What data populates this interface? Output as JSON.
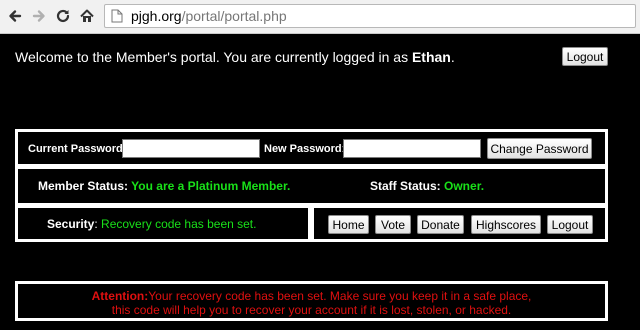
{
  "browser": {
    "url_domain": "pjgh.org",
    "url_path": "/portal/portal.php"
  },
  "welcome": {
    "prefix": "Welcome to the Member's portal. You are currently logged in as ",
    "username": "Ethan",
    "suffix": "."
  },
  "header": {
    "logout_label": "Logout"
  },
  "password": {
    "current_label": "Current Password",
    "new_label": "New Password",
    "colon": ":",
    "current_value": "",
    "new_value": "",
    "change_label": "Change Password"
  },
  "status": {
    "member_label": "Member Status:",
    "member_value": "You are a Platinum Member.",
    "staff_label": "Staff Status:",
    "staff_value": "Owner."
  },
  "security": {
    "label": "Security",
    "colon": ":",
    "value": "Recovery code has been set."
  },
  "nav": {
    "items": [
      "Home",
      "Vote",
      "Donate",
      "Highscores",
      "Logout"
    ]
  },
  "attention": {
    "label": "Attention:",
    "line1": "Your recovery code has been set. Make sure you keep it in a safe place,",
    "line2": "this code will help you to recover your account if it is lost, stolen, or hacked."
  },
  "colors": {
    "background": "#000000",
    "border": "#ffffff",
    "success": "#19e019",
    "alert": "#e01010"
  }
}
